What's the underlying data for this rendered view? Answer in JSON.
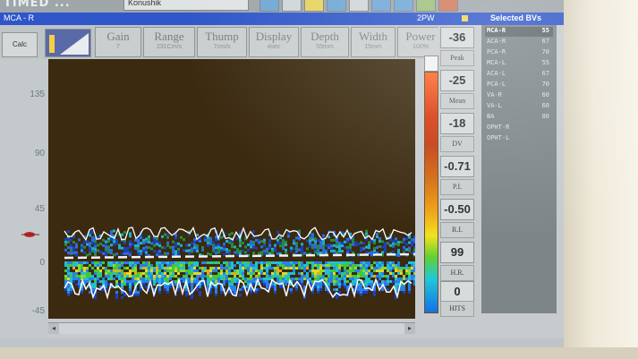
{
  "app": {
    "brand": "TIMED ...",
    "patient_name": "Konushik",
    "window_label": "MCA - R",
    "mode_label": "2PW",
    "selected_label": "Selected BVs"
  },
  "controls": {
    "calc_label": "Calc",
    "params": [
      {
        "label": "Gain",
        "value": "7"
      },
      {
        "label": "Range",
        "value": "231Cm/s"
      },
      {
        "label": "Thump",
        "value": "7cm/s"
      },
      {
        "label": "Display",
        "value": "4sec"
      },
      {
        "label": "Depth",
        "value": "55mm"
      },
      {
        "label": "Width",
        "value": "15mm"
      },
      {
        "label": "Power",
        "value": "100%"
      }
    ]
  },
  "scale": {
    "ticks": [
      "135",
      "90",
      "45",
      "0",
      "-45"
    ]
  },
  "measurements": [
    {
      "value": "-36",
      "label": "Peak"
    },
    {
      "value": "-25",
      "label": "Mean"
    },
    {
      "value": "-18",
      "label": "DV"
    },
    {
      "value": "-0.71",
      "label": "P.I."
    },
    {
      "value": "-0.50",
      "label": "R.I."
    },
    {
      "value": "99",
      "label": "H.R."
    },
    {
      "value": "0",
      "label": "HITS"
    }
  ],
  "vessels": [
    {
      "name": "MCA-R",
      "depth": "55",
      "selected": true
    },
    {
      "name": "ACA-R",
      "depth": "67"
    },
    {
      "name": "PCA-R",
      "depth": "70"
    },
    {
      "name": "MCA-L",
      "depth": "55"
    },
    {
      "name": "ACA-L",
      "depth": "67"
    },
    {
      "name": "PCA-L",
      "depth": "70"
    },
    {
      "name": "VA-R",
      "depth": "60"
    },
    {
      "name": "VA-L",
      "depth": "60"
    },
    {
      "name": "BA",
      "depth": "80"
    },
    {
      "name": "OPHT-R",
      "depth": ""
    },
    {
      "name": "OPHT-L",
      "depth": ""
    }
  ],
  "colors": {
    "titlebar": "#2f56c9",
    "spectrum_bg": "#3b2a10",
    "envelope": "#ffffff"
  }
}
